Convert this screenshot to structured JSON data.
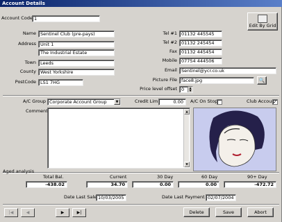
{
  "window": {
    "title": "Account Details"
  },
  "account_code": {
    "label": "Account Code",
    "value": "1"
  },
  "edit_by_grid": {
    "label": "Edit By Grid",
    "icon": "grid-icon"
  },
  "name": {
    "label": "Name",
    "value": "Sentinel Club (pre-pays)"
  },
  "address": {
    "label": "Address",
    "line1": "Unit 1",
    "line2": "The Industrial Estate"
  },
  "town": {
    "label": "Town",
    "value": "Leeds"
  },
  "county": {
    "label": "County",
    "value": "West Yorkshire"
  },
  "postcode": {
    "label": "PostCode",
    "value": "LS1 7HG"
  },
  "tel1": {
    "label": "Tel #1",
    "value": "01132 445545"
  },
  "tel2": {
    "label": "Tel #2",
    "value": "01132 245454"
  },
  "fax": {
    "label": "Fax",
    "value": "01132 445454"
  },
  "mobile": {
    "label": "Mobile",
    "value": "07754 444506"
  },
  "email": {
    "label": "Email",
    "value": "Sentinel@ycr.co.uk"
  },
  "picture_file": {
    "label": "Picture File",
    "value": "face8.jpg",
    "browse_icon": "search-icon"
  },
  "price_level": {
    "label": "Price level offset",
    "value": "0"
  },
  "ac_group": {
    "label": "A/C Group",
    "value": "Corporate Account Group"
  },
  "credit_limit": {
    "label": "Credit Limit",
    "value": "0.00"
  },
  "ac_on_stop": {
    "label": "A/C On Stop",
    "checked": false
  },
  "club_account": {
    "label": "Club Account",
    "checked": true,
    "mark": "✓"
  },
  "comments": {
    "label": "Comments",
    "value": ""
  },
  "aged": {
    "label": "Aged analysis",
    "headers": [
      "Total Bal.",
      "Current",
      "30 Day",
      "60 Day",
      "90+ Day"
    ],
    "values": [
      "-438.02",
      "34.70",
      "0.00",
      "0.00",
      "-472.72"
    ]
  },
  "date_last_sale": {
    "label": "Date Last Sale",
    "value": "10/03/2005"
  },
  "date_last_payment": {
    "label": "Date Last Payment",
    "value": "02/07/2004"
  },
  "nav": {
    "first": "|◀",
    "prev": "◀",
    "next": "▶",
    "last": "▶|"
  },
  "buttons": {
    "delete": "Delete",
    "save": "Save",
    "abort": "Abort"
  }
}
